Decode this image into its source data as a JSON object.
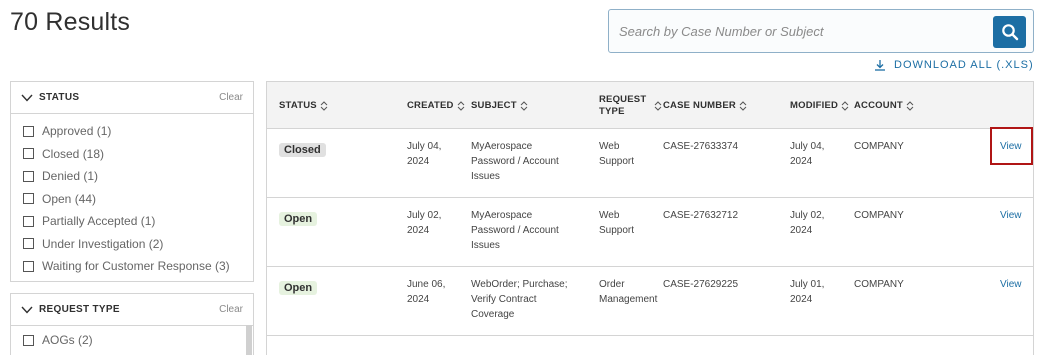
{
  "header": {
    "results_title": "70 Results",
    "search_placeholder": "Search by Case Number or Subject",
    "download_label": "DOWNLOAD ALL (.XLS)"
  },
  "filters": {
    "status": {
      "title": "STATUS",
      "clear": "Clear",
      "items": [
        "Approved (1)",
        "Closed (18)",
        "Denied (1)",
        "Open (44)",
        "Partially Accepted (1)",
        "Under Investigation (2)",
        "Waiting for Customer Response (3)"
      ]
    },
    "request_type": {
      "title": "REQUEST TYPE",
      "clear": "Clear",
      "items": [
        "AOGs (2)"
      ]
    }
  },
  "table": {
    "columns": {
      "status": "STATUS",
      "created": "CREATED",
      "subject": "SUBJECT",
      "request_type_1": "REQUEST",
      "request_type_2": "TYPE",
      "case_number": "CASE NUMBER",
      "modified": "MODIFIED",
      "account": "ACCOUNT"
    },
    "rows": [
      {
        "status": "Closed",
        "created_1": "July 04,",
        "created_2": "2024",
        "subject_1": "MyAerospace",
        "subject_2": "Password / Account",
        "subject_3": "Issues",
        "type_1": "Web",
        "type_2": "Support",
        "case": "CASE-27633374",
        "modified_1": "July 04,",
        "modified_2": "2024",
        "account": "COMPANY",
        "view": "View"
      },
      {
        "status": "Open",
        "created_1": "July 02,",
        "created_2": "2024",
        "subject_1": "MyAerospace",
        "subject_2": "Password / Account",
        "subject_3": "Issues",
        "type_1": "Web",
        "type_2": "Support",
        "case": "CASE-27632712",
        "modified_1": "July 02,",
        "modified_2": "2024",
        "account": "COMPANY",
        "view": "View"
      },
      {
        "status": "Open",
        "created_1": "June 06,",
        "created_2": "2024",
        "subject_1": "WebOrder; Purchase;",
        "subject_2": "Verify Contract",
        "subject_3": "Coverage",
        "type_1": "Order",
        "type_2": "Management",
        "case": "CASE-27629225",
        "modified_1": "July 01,",
        "modified_2": "2024",
        "account": "COMPANY",
        "view": "View"
      }
    ]
  },
  "colors": {
    "accent": "#1c6ea4",
    "highlight": "#b01515",
    "closed_badge": "#e0e0e0",
    "open_badge": "#e6f2df"
  }
}
